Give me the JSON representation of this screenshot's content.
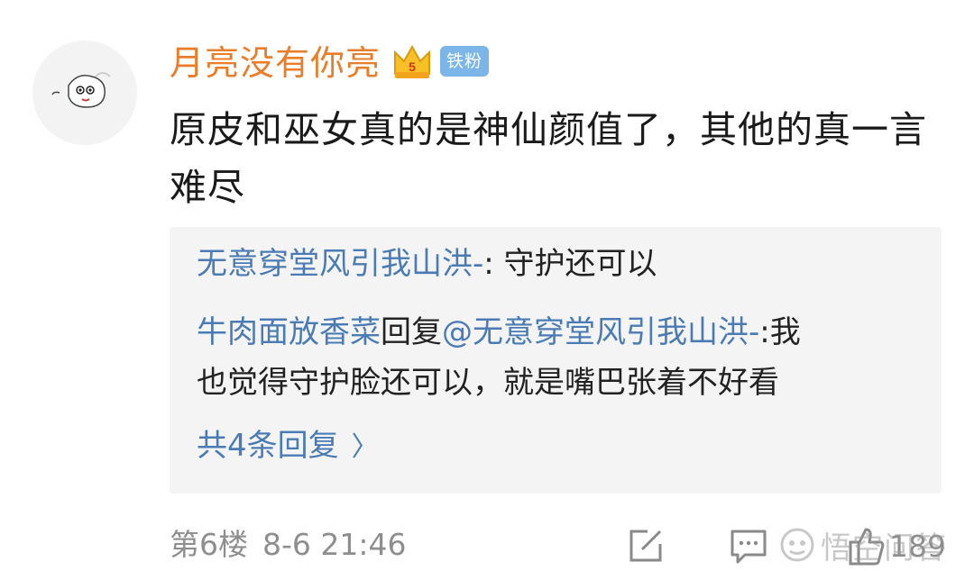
{
  "comment": {
    "username": "月亮没有你亮",
    "badge": "铁粉",
    "text": "原皮和巫女真的是神仙颜值了，其他的真一言难尽"
  },
  "replies": {
    "items": [
      {
        "author": "无意穿堂风引我山洪-",
        "separator": ": ",
        "text": "守护还可以"
      },
      {
        "author": "牛肉面放香菜",
        "action": "回复",
        "mention": "@无意穿堂风引我山洪-",
        "separator": ":",
        "text_line1": "我",
        "text_line2": "也觉得守护脸还可以，就是嘴巴张着不好看"
      }
    ],
    "more_label": "共4条回复",
    "more_chevron": "〉"
  },
  "footer": {
    "floor": "第6楼",
    "time": "8-6 21:46",
    "like_count": "189"
  },
  "watermark": "悟空问答",
  "icons": [
    "avatar",
    "crown-icon",
    "edit-icon",
    "comment-icon",
    "like-icon",
    "watermark-logo-icon"
  ],
  "colors": {
    "username": "#ea7d29",
    "link": "#4a7bb4",
    "badge_bg": "#7cb6e8",
    "reply_bg": "#f4f4f4",
    "meta": "#8e8e8e"
  }
}
